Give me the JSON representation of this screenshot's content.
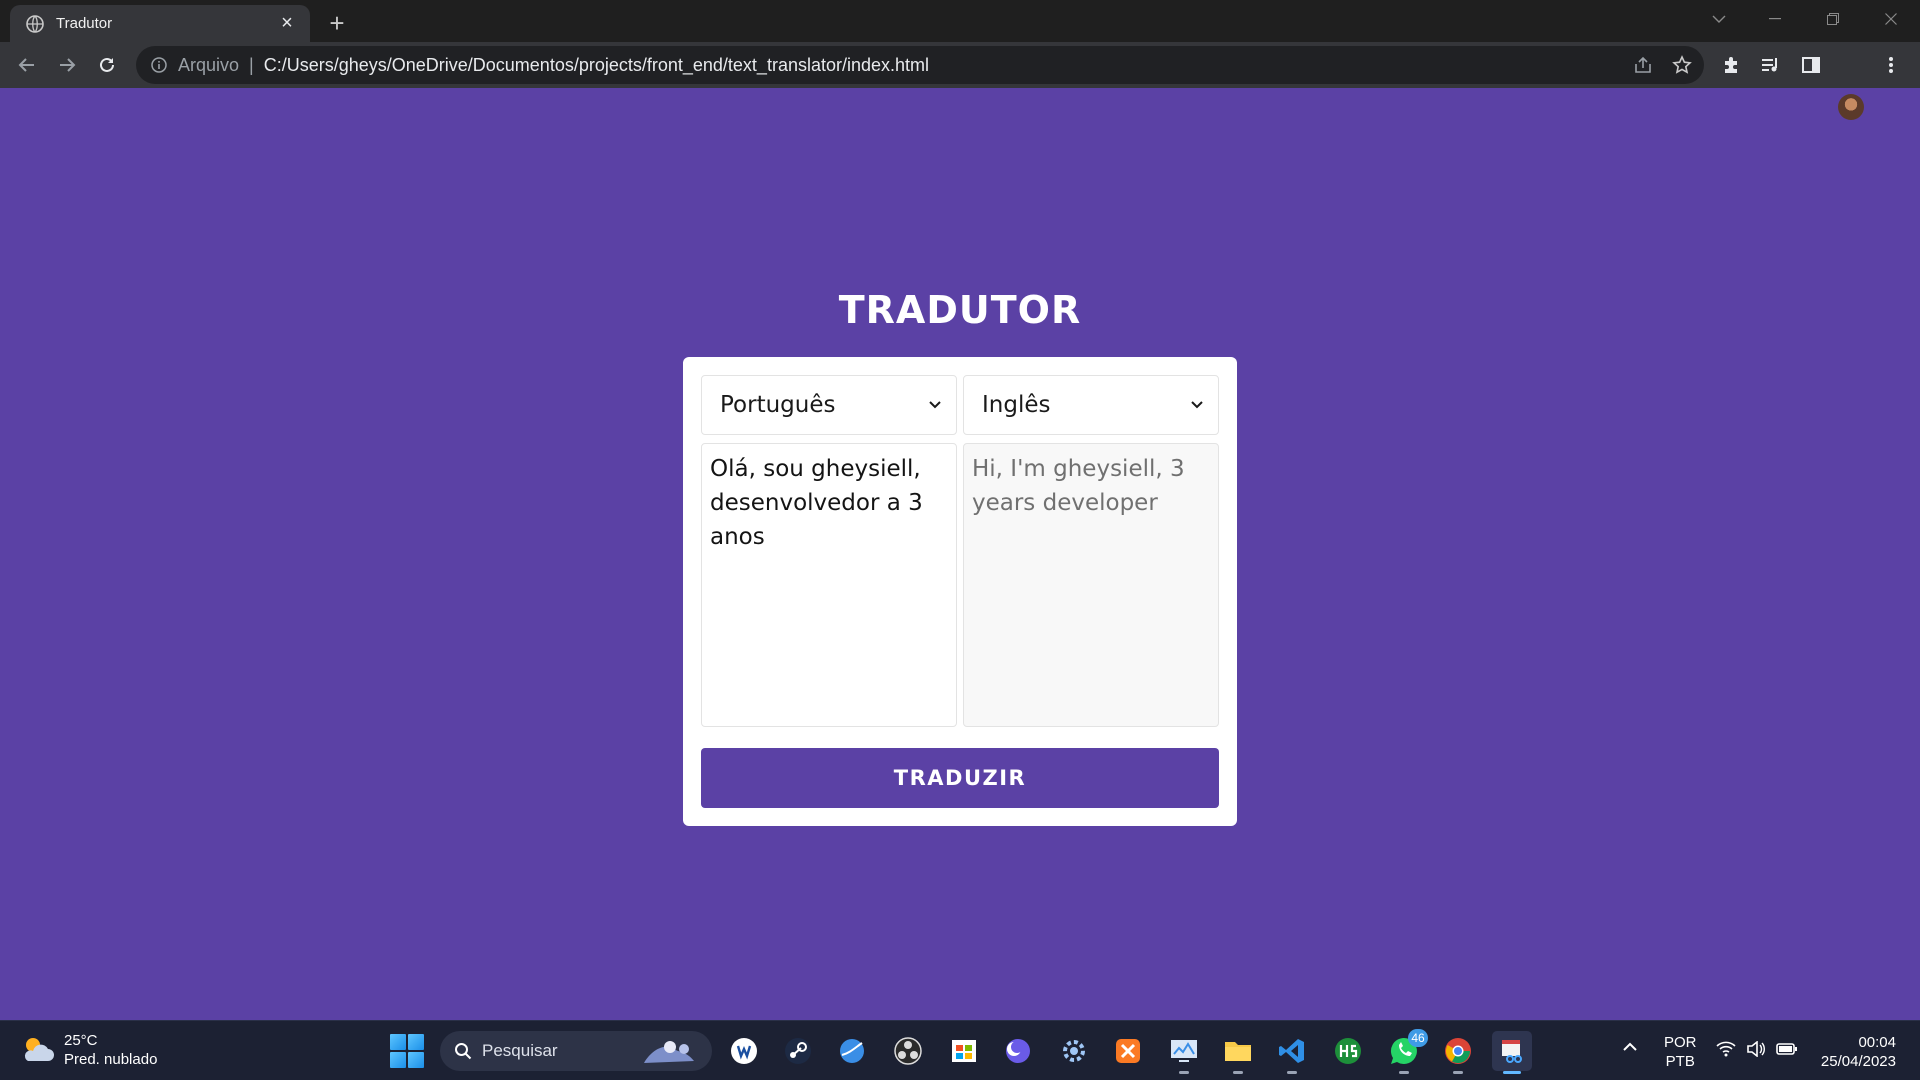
{
  "browser": {
    "tab_title": "Tradutor",
    "new_tab_symbol": "+",
    "close_symbol": "×",
    "address_scheme": "Arquivo",
    "address_separator": "|",
    "address_url": "C:/Users/gheys/OneDrive/Documentos/projects/front_end/text_translator/index.html"
  },
  "page": {
    "title": "TRADUTOR",
    "source_language": "Português",
    "target_language": "Inglês",
    "source_text": "Olá, sou gheysiell, desenvolvedor a 3 anos",
    "translated_text": "Hi, I'm gheysiell, 3 years developer",
    "translate_button": "TRADUZIR"
  },
  "taskbar": {
    "weather_temp": "25°C",
    "weather_desc": "Pred. nublado",
    "search_label": "Pesquisar",
    "whatsapp_badge": "46",
    "input_lang_1": "POR",
    "input_lang_2": "PTB",
    "time": "00:04",
    "date": "25/04/2023"
  },
  "colors": {
    "page_background": "#5b41a5",
    "button": "#5b41a5",
    "card": "#ffffff"
  },
  "icons": [
    "globe-icon",
    "info-icon",
    "share-icon",
    "star-icon",
    "puzzle-icon",
    "media-icon",
    "sidepanel-icon",
    "kebab-icon",
    "windows-icon",
    "search-icon",
    "steam-icon",
    "obs-icon",
    "vscode-icon",
    "whatsapp-icon",
    "chrome-icon",
    "folder-icon",
    "wifi-icon",
    "volume-icon",
    "battery-icon"
  ]
}
